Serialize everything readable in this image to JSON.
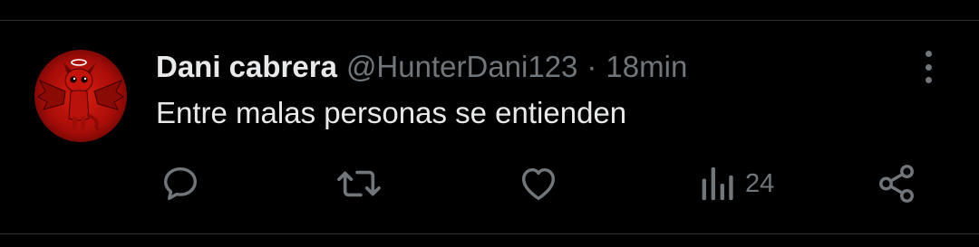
{
  "tweet": {
    "author_name": "Dani cabrera",
    "author_handle": "@HunterDani123",
    "separator": "·",
    "timestamp": "18min",
    "text": "Entre malas personas se entienden"
  },
  "actions": {
    "views_count": "24"
  },
  "icons": {
    "avatar": "red-devil-avatar",
    "more": "more-options-icon",
    "reply": "reply-icon",
    "retweet": "retweet-icon",
    "like": "heart-icon",
    "views": "views-icon",
    "share": "share-icon"
  },
  "colors": {
    "background": "#000000",
    "text_primary": "#e7e9ea",
    "text_secondary": "#71767b",
    "divider": "#2f3336",
    "avatar_red": "#d81e12"
  }
}
